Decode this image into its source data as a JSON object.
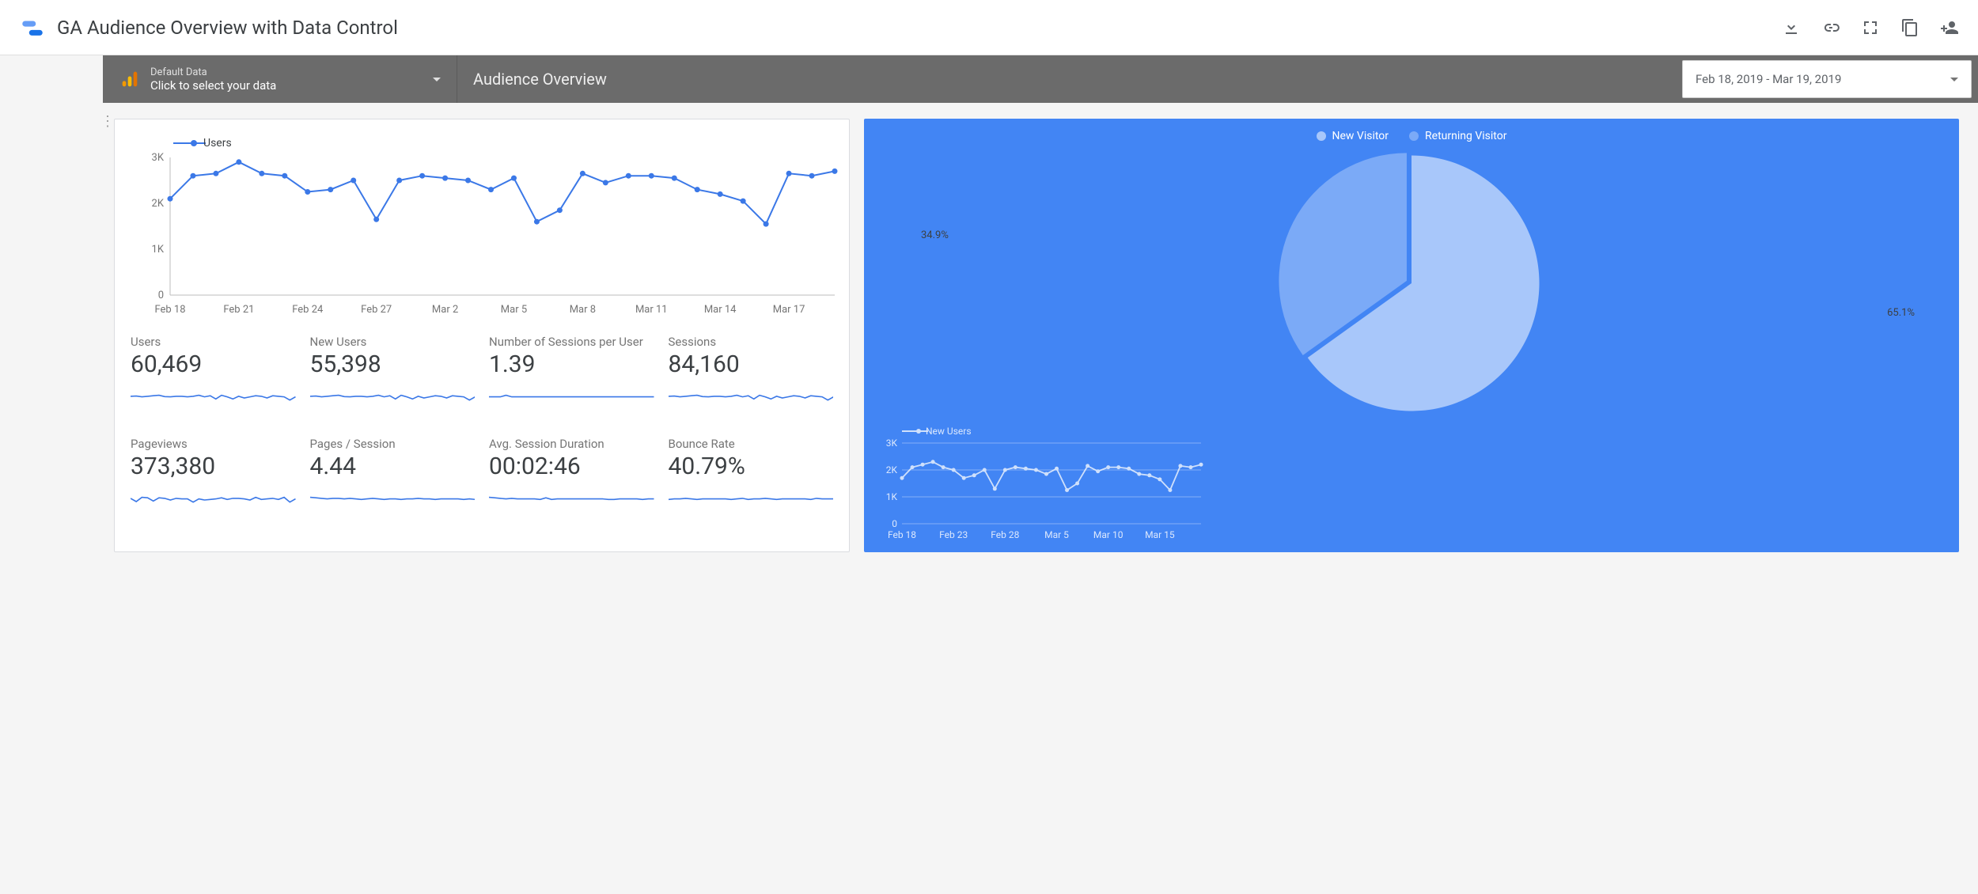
{
  "header": {
    "title": "GA Audience Overview with Data Control",
    "actions": [
      "download",
      "link",
      "fullscreen",
      "copy",
      "add-person"
    ]
  },
  "controlbar": {
    "datasource": {
      "small": "Default Data",
      "main": "Click to select your data"
    },
    "page_title": "Audience Overview",
    "date_range": "Feb 18, 2019 - Mar 19, 2019"
  },
  "chart_data": [
    {
      "id": "main_users_line",
      "type": "line",
      "title": "",
      "legend": [
        "Users"
      ],
      "xlabel": "",
      "ylabel": "",
      "ylim": [
        0,
        3000
      ],
      "yticks": [
        0,
        "1K",
        "2K",
        "3K"
      ],
      "categories": [
        "Feb 18",
        "Feb 19",
        "Feb 20",
        "Feb 21",
        "Feb 22",
        "Feb 23",
        "Feb 24",
        "Feb 25",
        "Feb 26",
        "Feb 27",
        "Feb 28",
        "Mar 1",
        "Mar 2",
        "Mar 3",
        "Mar 4",
        "Mar 5",
        "Mar 6",
        "Mar 7",
        "Mar 8",
        "Mar 9",
        "Mar 10",
        "Mar 11",
        "Mar 12",
        "Mar 13",
        "Mar 14",
        "Mar 15",
        "Mar 16",
        "Mar 17",
        "Mar 18",
        "Mar 19"
      ],
      "xticks": [
        "Feb 18",
        "Feb 21",
        "Feb 24",
        "Feb 27",
        "Mar 2",
        "Mar 5",
        "Mar 8",
        "Mar 11",
        "Mar 14",
        "Mar 17"
      ],
      "values": [
        2100,
        2600,
        2650,
        2900,
        2650,
        2600,
        2250,
        2300,
        2500,
        1650,
        2500,
        2600,
        2550,
        2500,
        2300,
        2550,
        1600,
        1850,
        2650,
        2450,
        2600,
        2600,
        2550,
        2300,
        2200,
        2050,
        1550,
        2650,
        2600,
        2700
      ]
    },
    {
      "id": "visitor_pie",
      "type": "pie",
      "legend": [
        {
          "name": "New Visitor",
          "value": 65.1,
          "color": "#a8c7fa"
        },
        {
          "name": "Returning Visitor",
          "value": 34.9,
          "color": "#7baaf7"
        }
      ],
      "labels": [
        "34.9%",
        "65.1%"
      ]
    },
    {
      "id": "side_new_users_line",
      "type": "line",
      "legend": [
        "New Users"
      ],
      "ylim": [
        0,
        3000
      ],
      "yticks": [
        0,
        "1K",
        "2K",
        "3K"
      ],
      "categories": [
        "Feb 18",
        "Feb 19",
        "Feb 20",
        "Feb 21",
        "Feb 22",
        "Feb 23",
        "Feb 24",
        "Feb 25",
        "Feb 26",
        "Feb 27",
        "Feb 28",
        "Mar 1",
        "Mar 2",
        "Mar 3",
        "Mar 4",
        "Mar 5",
        "Mar 6",
        "Mar 7",
        "Mar 8",
        "Mar 9",
        "Mar 10",
        "Mar 11",
        "Mar 12",
        "Mar 13",
        "Mar 14",
        "Mar 15",
        "Mar 16",
        "Mar 17",
        "Mar 18",
        "Mar 19"
      ],
      "xticks": [
        "Feb 18",
        "Feb 23",
        "Feb 28",
        "Mar 5",
        "Mar 10",
        "Mar 15"
      ],
      "values": [
        1700,
        2100,
        2200,
        2300,
        2100,
        2000,
        1700,
        1800,
        2000,
        1300,
        2000,
        2100,
        2050,
        2000,
        1850,
        2050,
        1250,
        1500,
        2150,
        1950,
        2100,
        2100,
        2050,
        1850,
        1800,
        1650,
        1250,
        2150,
        2100,
        2200
      ]
    }
  ],
  "metrics": [
    {
      "label": "Users",
      "value": "60,469",
      "spark": [
        62,
        63,
        60,
        62,
        64,
        66,
        61,
        60,
        62,
        62,
        60,
        62,
        66,
        60,
        64,
        52,
        66,
        60,
        52,
        62,
        56,
        60,
        64,
        62,
        56,
        64,
        62,
        60,
        48,
        60
      ]
    },
    {
      "label": "New Users",
      "value": "55,398",
      "spark": [
        62,
        63,
        60,
        62,
        64,
        66,
        61,
        60,
        62,
        62,
        60,
        62,
        66,
        60,
        64,
        52,
        66,
        60,
        52,
        62,
        56,
        60,
        64,
        62,
        56,
        64,
        62,
        60,
        48,
        60
      ]
    },
    {
      "label": "Number of Sessions per User",
      "value": "1.39",
      "spark": [
        60,
        60,
        60,
        66,
        60,
        60,
        60,
        60,
        60,
        60,
        60,
        60,
        60,
        60,
        60,
        60,
        60,
        60,
        60,
        60,
        60,
        60,
        60,
        60,
        60,
        60,
        60,
        60,
        60,
        60
      ]
    },
    {
      "label": "Sessions",
      "value": "84,160",
      "spark": [
        62,
        63,
        60,
        62,
        64,
        66,
        61,
        60,
        62,
        62,
        60,
        62,
        66,
        60,
        64,
        52,
        66,
        60,
        52,
        62,
        56,
        60,
        64,
        62,
        56,
        64,
        62,
        60,
        48,
        60
      ]
    },
    {
      "label": "Pageviews",
      "value": "373,380",
      "spark": [
        62,
        50,
        66,
        64,
        52,
        64,
        62,
        56,
        62,
        60,
        60,
        48,
        60,
        56,
        58,
        60,
        64,
        58,
        62,
        62,
        60,
        56,
        66,
        58,
        60,
        62,
        58,
        66,
        48,
        60
      ]
    },
    {
      "label": "Pages / Session",
      "value": "4.44",
      "spark": [
        66,
        64,
        62,
        60,
        62,
        62,
        60,
        62,
        60,
        58,
        60,
        62,
        60,
        58,
        60,
        60,
        58,
        60,
        60,
        62,
        60,
        60,
        58,
        60,
        60,
        60,
        60,
        58,
        60,
        58
      ]
    },
    {
      "label": "Avg. Session Duration",
      "value": "00:02:46",
      "spark": [
        66,
        64,
        62,
        60,
        62,
        60,
        60,
        60,
        60,
        58,
        64,
        58,
        60,
        60,
        60,
        60,
        60,
        60,
        60,
        60,
        60,
        58,
        58,
        60,
        60,
        60,
        60,
        58,
        60,
        60
      ]
    },
    {
      "label": "Bounce Rate",
      "value": "40.79%",
      "spark": [
        58,
        60,
        60,
        62,
        60,
        58,
        60,
        60,
        60,
        60,
        60,
        58,
        60,
        62,
        58,
        60,
        60,
        62,
        60,
        58,
        60,
        60,
        60,
        60,
        60,
        58,
        62,
        60,
        60,
        60
      ]
    }
  ]
}
